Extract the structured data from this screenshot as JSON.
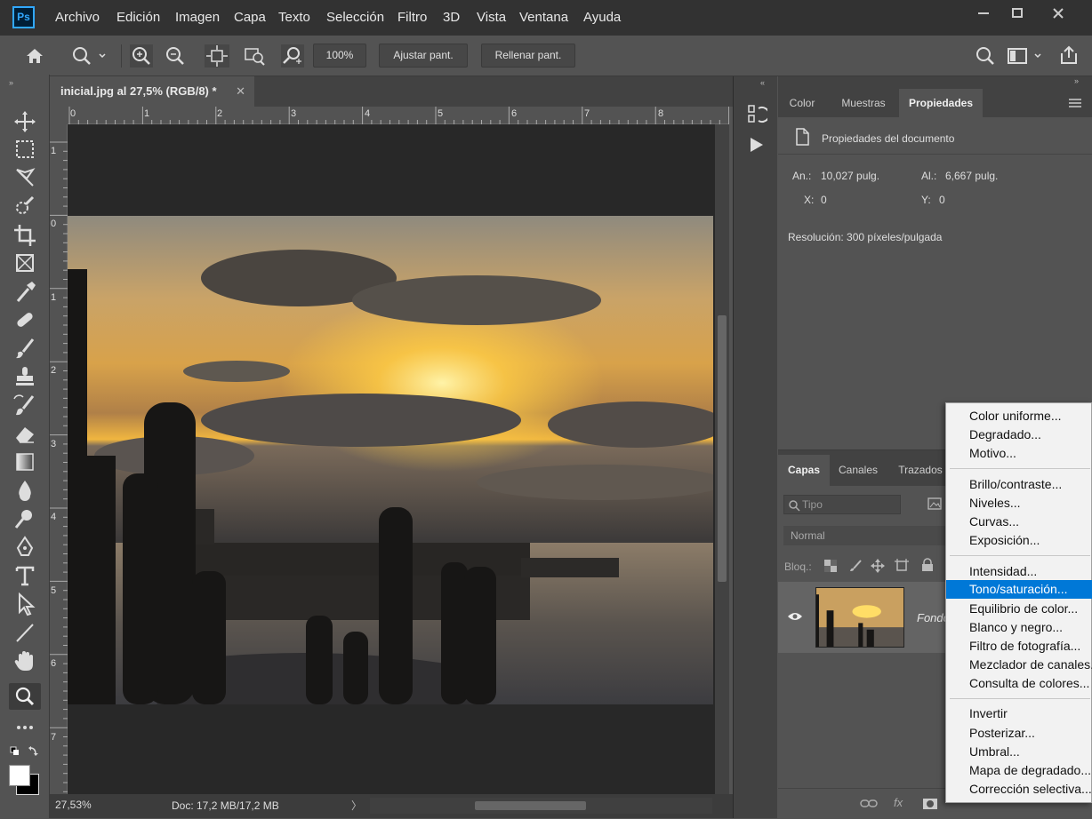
{
  "app": {
    "logo": "Ps"
  },
  "menu": [
    "Archivo",
    "Edición",
    "Imagen",
    "Capa",
    "Texto",
    "Selección",
    "Filtro",
    "3D",
    "Vista",
    "Ventana",
    "Ayuda"
  ],
  "options": {
    "zoom_value": "100%",
    "fit_label": "Ajustar pant.",
    "fill_label": "Rellenar pant."
  },
  "document": {
    "tab_title": "inicial.jpg al 27,5% (RGB/8) *",
    "ruler_h": [
      "0",
      "1",
      "2",
      "3",
      "4",
      "5",
      "6",
      "7",
      "8"
    ],
    "ruler_v": [
      "1",
      "0",
      "1",
      "2",
      "3",
      "4",
      "5",
      "6",
      "7"
    ],
    "zoom": "27,53%",
    "doc_info": "Doc: 17,2 MB/17,2 MB"
  },
  "properties": {
    "tabs": [
      "Color",
      "Muestras",
      "Propiedades"
    ],
    "active_tab": "Propiedades",
    "header": "Propiedades del documento",
    "width_label": "An.:",
    "width_value": "10,027 pulg.",
    "height_label": "Al.:",
    "height_value": "6,667 pulg.",
    "x_label": "X:",
    "x_value": "0",
    "y_label": "Y:",
    "y_value": "0",
    "resolution": "Resolución: 300 píxeles/pulgada"
  },
  "layers": {
    "tabs": [
      "Capas",
      "Canales",
      "Trazados"
    ],
    "search_placeholder": "Tipo",
    "blend_mode": "Normal",
    "lock_label": "Bloq.:",
    "layer_name": "Fondo"
  },
  "context_menu": {
    "groups": [
      [
        "Color uniforme...",
        "Degradado...",
        "Motivo..."
      ],
      [
        "Brillo/contraste...",
        "Niveles...",
        "Curvas...",
        "Exposición..."
      ],
      [
        "Intensidad...",
        "Tono/saturación...",
        "Equilibrio de color...",
        "Blanco y negro...",
        "Filtro de fotografía...",
        "Mezclador de canales...",
        "Consulta de colores..."
      ],
      [
        "Invertir",
        "Posterizar...",
        "Umbral...",
        "Mapa de degradado...",
        "Corrección selectiva..."
      ]
    ],
    "highlighted": "Tono/saturación..."
  },
  "colors": {
    "accent": "#0078d7",
    "ps_blue": "#31a8ff"
  }
}
